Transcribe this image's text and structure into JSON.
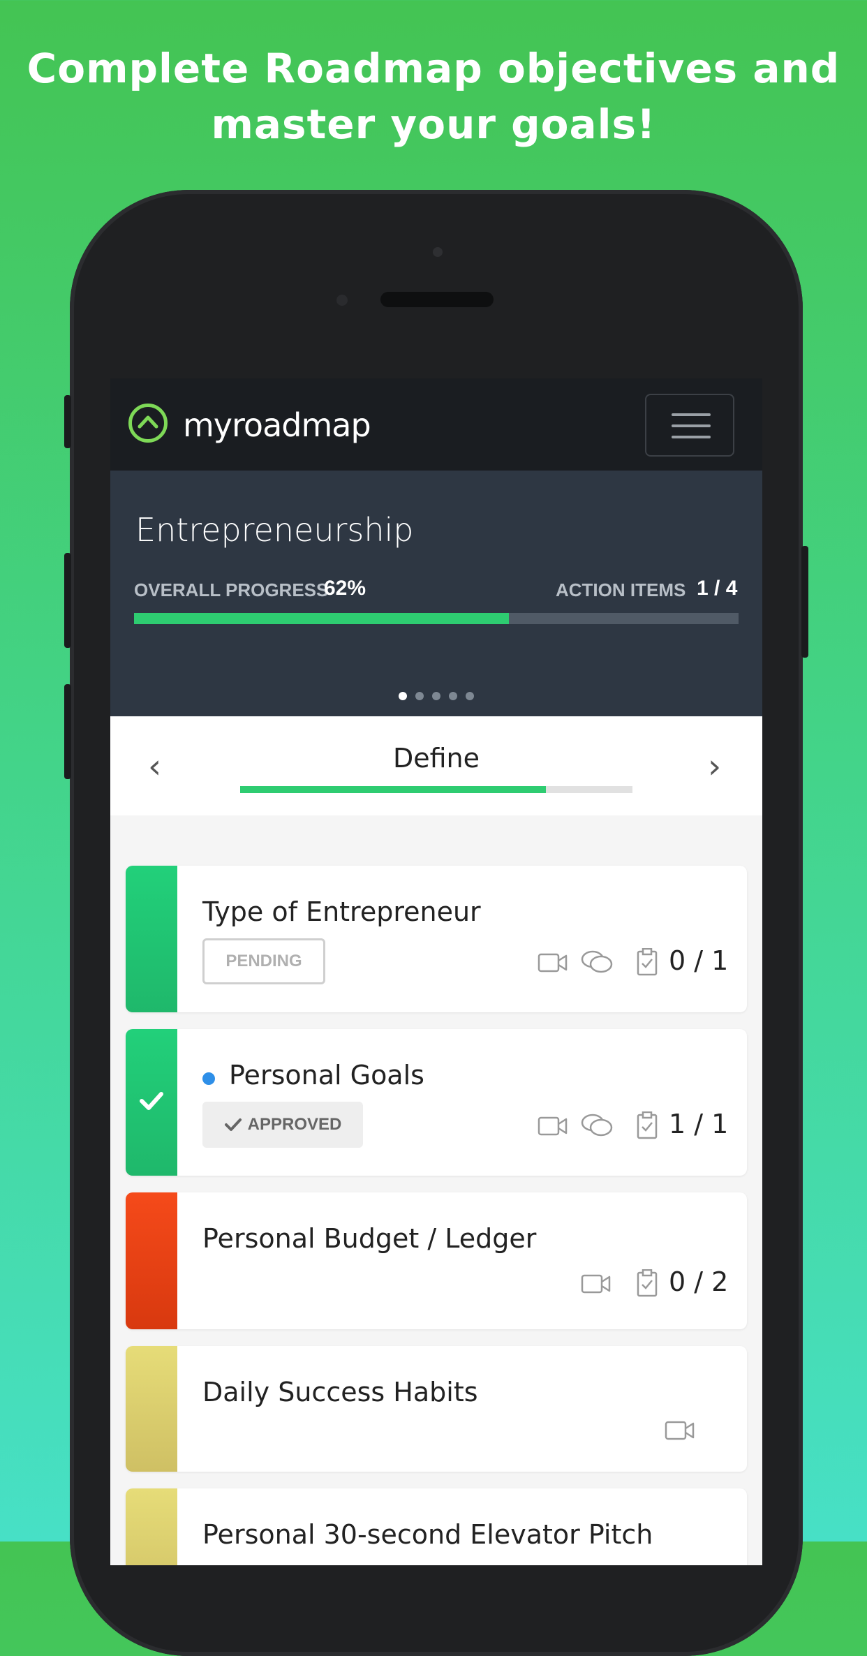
{
  "headline": {
    "line1": "Complete Roadmap objectives and",
    "line2": "master your goals!"
  },
  "app": {
    "logo_text": "myroadmap"
  },
  "roadmap": {
    "title": "Entrepreneurship",
    "overall_progress_label": "OVERALL PROGRESS",
    "overall_progress_value": "62%",
    "overall_progress_fraction": 0.62,
    "action_items_label": "ACTION ITEMS",
    "action_items_value": "1 / 4",
    "carousel_pages": 5,
    "carousel_active_index": 0
  },
  "stage": {
    "title": "Define",
    "progress_fraction": 0.78,
    "prev_icon": "chevron-left-icon",
    "next_icon": "chevron-right-icon"
  },
  "colors": {
    "green": "#2ecc71",
    "orange": "#f0441a",
    "yellow": "#e4d87a",
    "blue_dot": "#2e8fe8"
  },
  "objectives": [
    {
      "title": "Type of Entrepreneur",
      "status": "PENDING",
      "count": "0 / 1",
      "icons": [
        "video-icon",
        "comments-icon",
        "clipboard-icon"
      ]
    },
    {
      "title": "Personal Goals",
      "status": "APPROVED",
      "count": "1 / 1",
      "icons": [
        "video-icon",
        "comments-icon",
        "clipboard-icon"
      ]
    },
    {
      "title": "Personal Budget / Ledger",
      "count": "0 / 2",
      "icons": [
        "video-icon",
        "clipboard-icon"
      ]
    },
    {
      "title": "Daily Success Habits",
      "icons": [
        "video-icon"
      ]
    },
    {
      "title": "Personal 30-second Elevator Pitch"
    }
  ]
}
